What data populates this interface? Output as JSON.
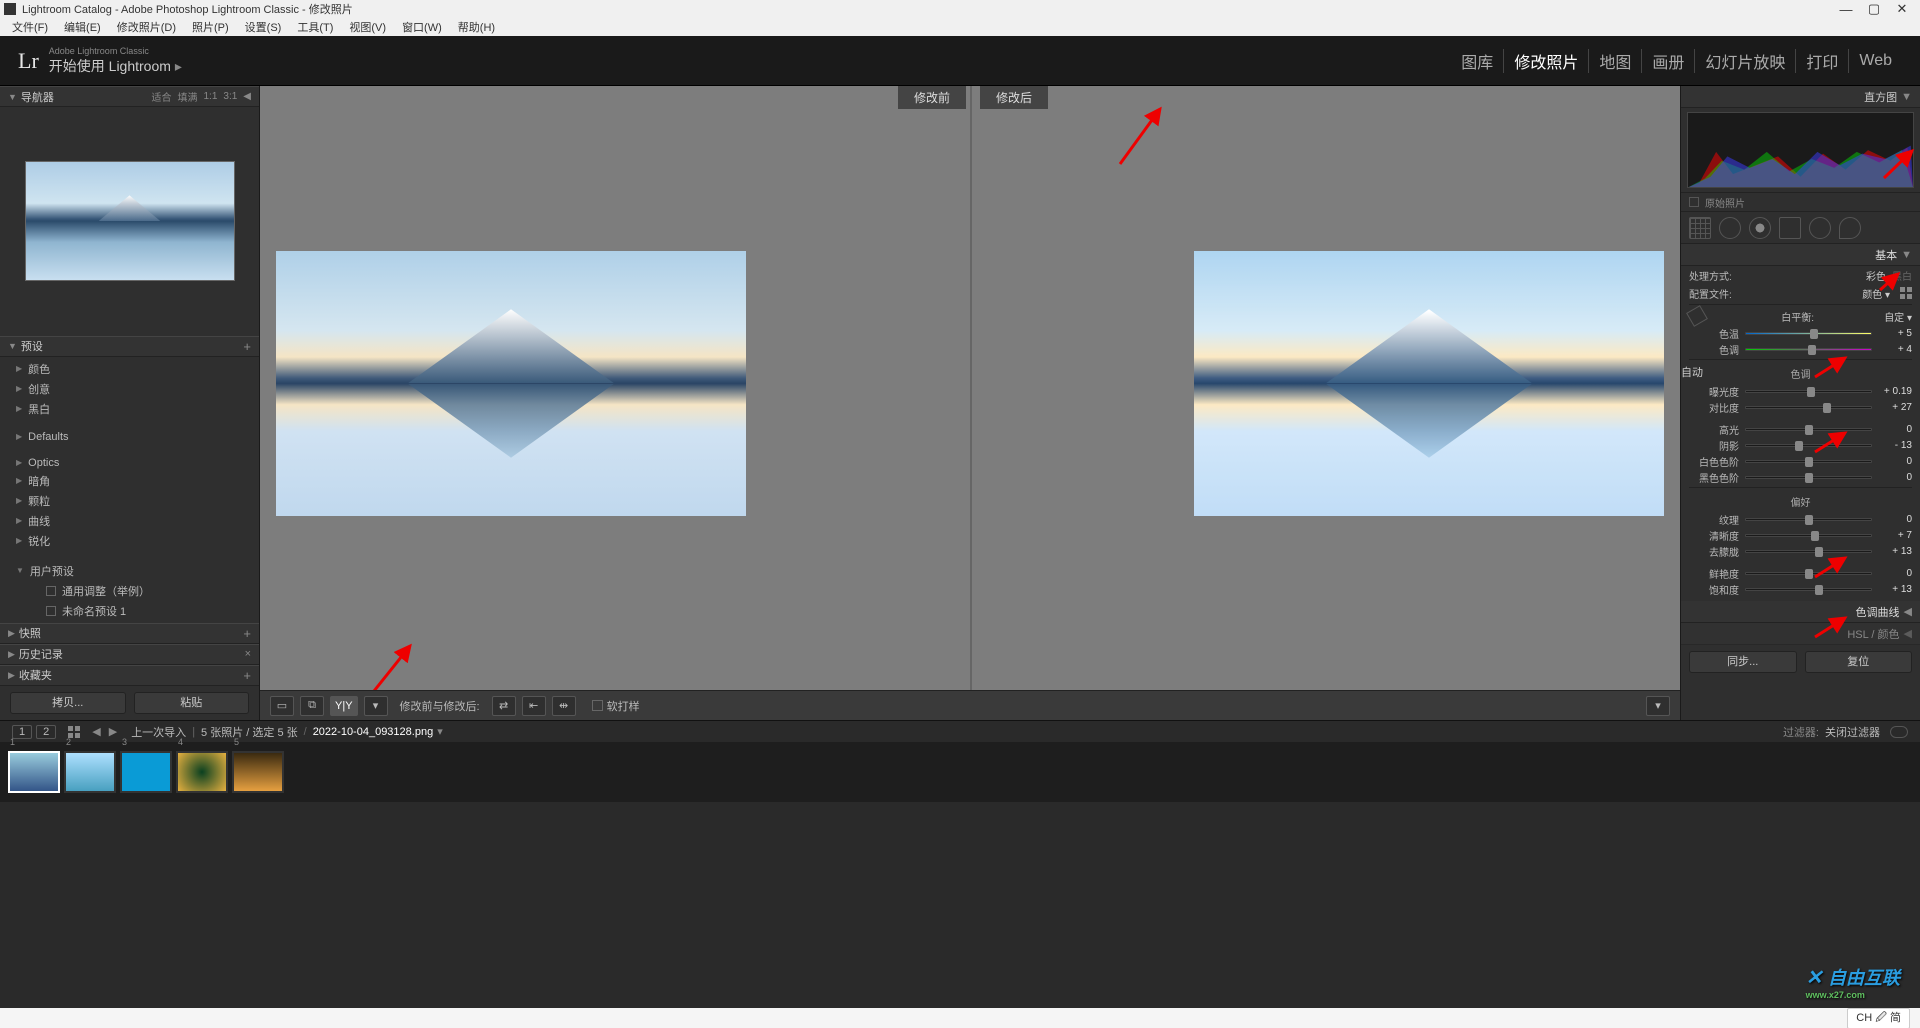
{
  "titlebar": {
    "title": "Lightroom Catalog - Adobe Photoshop Lightroom Classic - 修改照片"
  },
  "menubar": [
    "文件(F)",
    "编辑(E)",
    "修改照片(D)",
    "照片(P)",
    "设置(S)",
    "工具(T)",
    "视图(V)",
    "窗口(W)",
    "帮助(H)"
  ],
  "brand": {
    "logo": "Lr",
    "small": "Adobe Lightroom Classic",
    "main": "开始使用 Lightroom",
    "arrow": "▸"
  },
  "modules": [
    "图库",
    "修改照片",
    "地图",
    "画册",
    "幻灯片放映",
    "打印",
    "Web"
  ],
  "module_active": 1,
  "left": {
    "navigator": {
      "label": "导航器",
      "options": [
        "适合",
        "填满",
        "1:1",
        "3:1"
      ],
      "tri": "◀"
    },
    "presets": {
      "label": "预设",
      "items": [
        "颜色",
        "创意",
        "黑白"
      ],
      "defaults": "Defaults",
      "group2": [
        "Optics",
        "暗角",
        "颗粒",
        "曲线",
        "锐化"
      ],
      "user": {
        "label": "用户预设",
        "items": [
          "通用调整（举例）",
          "未命名预设 1"
        ]
      }
    },
    "snapshots": "快照",
    "history": "历史记录",
    "collections": "收藏夹",
    "copy": "拷贝...",
    "paste": "粘贴"
  },
  "compare": {
    "before": "修改前",
    "after": "修改后"
  },
  "toolbar": {
    "before_after": "修改前与修改后:",
    "softproof": "软打样"
  },
  "right": {
    "histogram": "直方图",
    "original": "原始照片",
    "basic": "基本",
    "treatment": {
      "label": "处理方式:",
      "color": "彩色",
      "bw": "黑白"
    },
    "profile": {
      "label": "配置文件:",
      "value": "颜色"
    },
    "wb": {
      "label": "白平衡:",
      "value": "自定"
    },
    "sliders_wb": [
      {
        "name": "色温",
        "val": "+ 5",
        "pos": 54
      },
      {
        "name": "色调",
        "val": "+ 4",
        "pos": 53
      }
    ],
    "tone_head": "色调",
    "auto": "自动",
    "sliders_tone": [
      {
        "name": "曝光度",
        "val": "+ 0.19",
        "pos": 52
      },
      {
        "name": "对比度",
        "val": "+ 27",
        "pos": 65
      },
      {
        "name": "高光",
        "val": "0",
        "pos": 50
      },
      {
        "name": "阴影",
        "val": "- 13",
        "pos": 42
      },
      {
        "name": "白色色阶",
        "val": "0",
        "pos": 50
      },
      {
        "name": "黑色色阶",
        "val": "0",
        "pos": 50
      }
    ],
    "presence_head": "偏好",
    "sliders_presence": [
      {
        "name": "纹理",
        "val": "0",
        "pos": 50
      },
      {
        "name": "清晰度",
        "val": "+ 7",
        "pos": 55
      },
      {
        "name": "去朦胧",
        "val": "+ 13",
        "pos": 58
      },
      {
        "name": "鲜艳度",
        "val": "0",
        "pos": 50
      },
      {
        "name": "饱和度",
        "val": "+ 13",
        "pos": 58
      }
    ],
    "tonecurve": "色调曲线",
    "hsl": "HSL / 颜色",
    "sync": "同步...",
    "reset": "复位"
  },
  "info": {
    "pages": [
      "1",
      "2"
    ],
    "prev_import": "上一次导入",
    "count": "5 张照片 / 选定 5 张",
    "filename": "2022-10-04_093128.png",
    "filter_label": "过滤器:",
    "filter_value": "关闭过滤器"
  },
  "ime": "CH 🖉 简",
  "watermark": {
    "main": "自由互联",
    "url": "www.x27.com"
  }
}
